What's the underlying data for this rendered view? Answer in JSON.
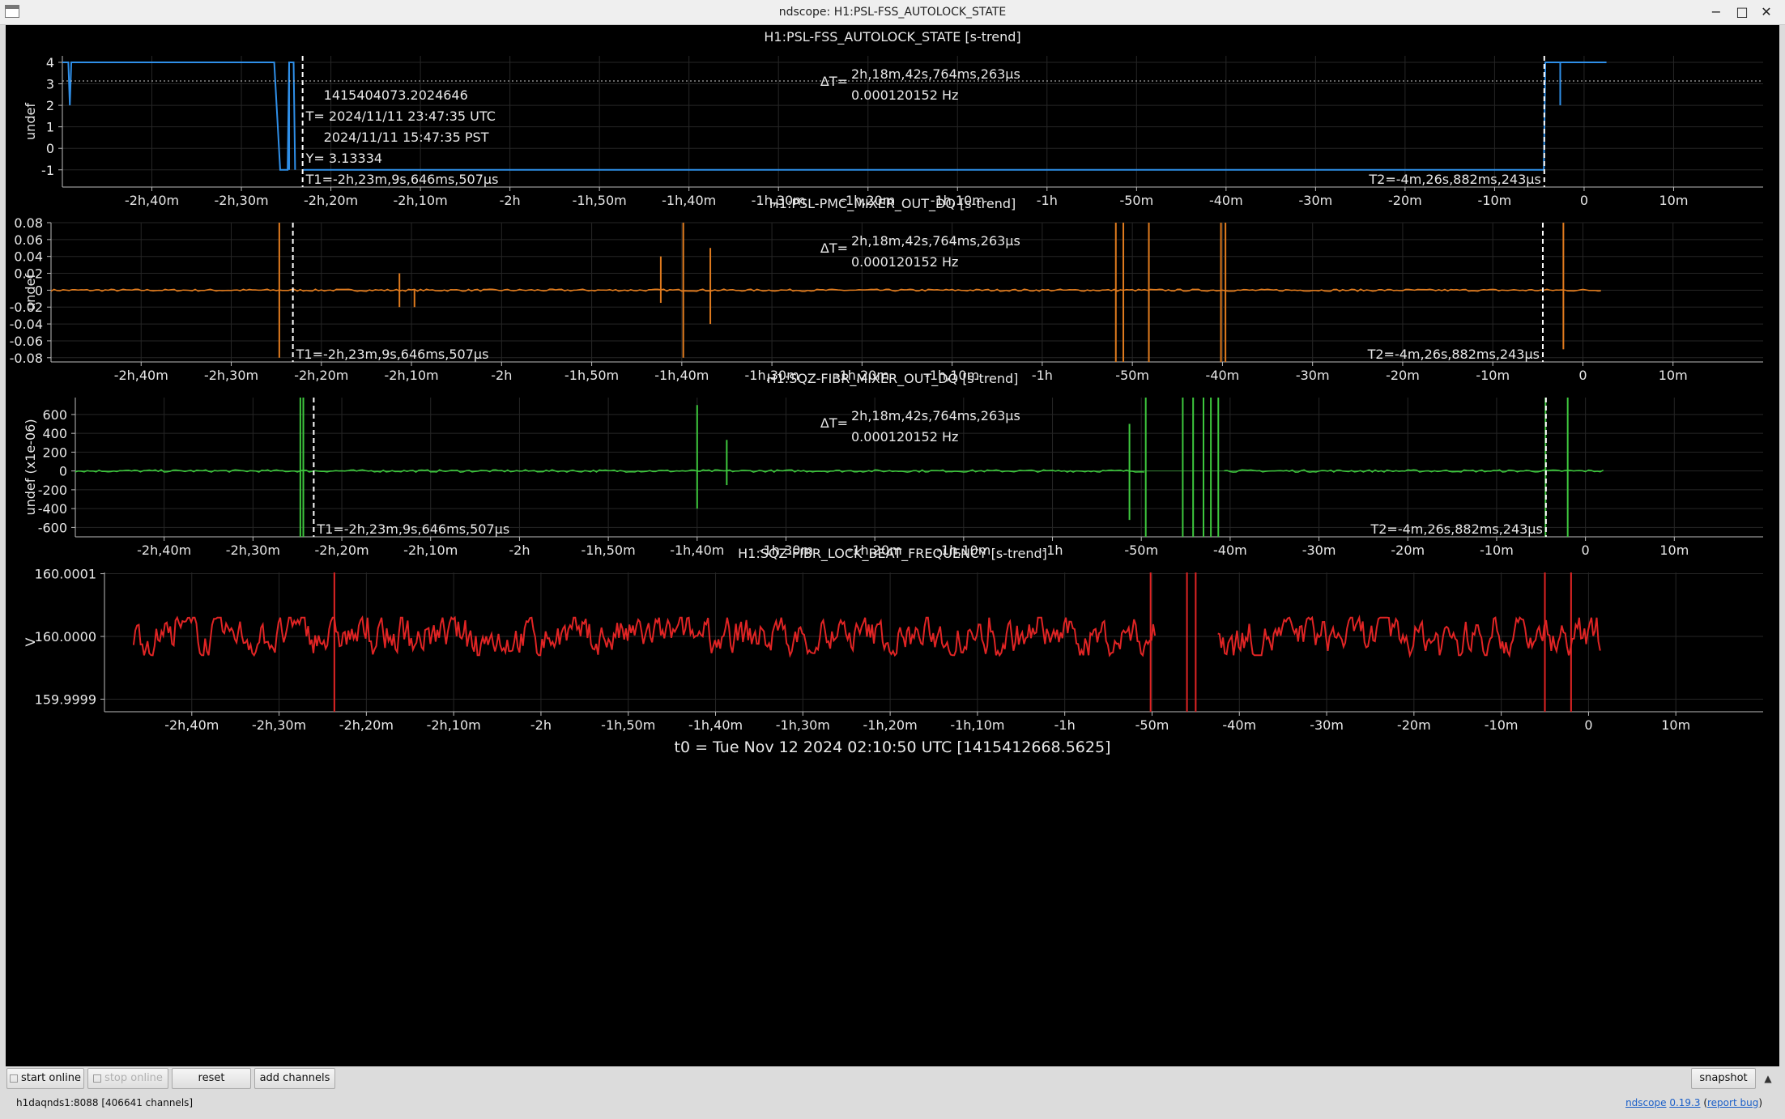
{
  "window": {
    "title": "ndscope: H1:PSL-FSS_AUTOLOCK_STATE",
    "minimize": "−",
    "restore": "□",
    "close": "✕"
  },
  "xaxis": {
    "range": [
      -10200,
      1200
    ],
    "ticks": [
      {
        "v": -9600,
        "label": "-2h,40m"
      },
      {
        "v": -9000,
        "label": "-2h,30m"
      },
      {
        "v": -8400,
        "label": "-2h,20m"
      },
      {
        "v": -7800,
        "label": "-2h,10m"
      },
      {
        "v": -7200,
        "label": "-2h"
      },
      {
        "v": -6600,
        "label": "-1h,50m"
      },
      {
        "v": -6000,
        "label": "-1h,40m"
      },
      {
        "v": -5400,
        "label": "-1h,30m"
      },
      {
        "v": -4800,
        "label": "-1h,20m"
      },
      {
        "v": -4200,
        "label": "-1h,10m"
      },
      {
        "v": -3600,
        "label": "-1h"
      },
      {
        "v": -3000,
        "label": "-50m"
      },
      {
        "v": -2400,
        "label": "-40m"
      },
      {
        "v": -1800,
        "label": "-30m"
      },
      {
        "v": -1200,
        "label": "-20m"
      },
      {
        "v": -600,
        "label": "-10m"
      },
      {
        "v": 0,
        "label": "0"
      },
      {
        "v": 600,
        "label": "10m"
      }
    ]
  },
  "cursors": {
    "t1": -8589.6,
    "t2": -266.9,
    "t1_label": "T1=-2h,23m,9s,646ms,507µs",
    "t2_label": "T2=-4m,26s,882ms,243µs",
    "dt_prefix": "ΔT=",
    "dt_value": "2h,18m,42s,764ms,263µs",
    "dt_freq": "0.000120152 Hz",
    "y_cursor": 3.13334,
    "readout": {
      "gps": "1415404073.2024646",
      "utc": "T= 2024/11/11 23:47:35 UTC",
      "pst": "2024/11/11 15:47:35 PST",
      "y": "Y= 3.13334"
    }
  },
  "t0_label": "t0 = Tue Nov 12 2024 02:10:50 UTC [1415412668.5625]",
  "chart_data": [
    {
      "type": "line",
      "title": "H1:PSL-FSS_AUTOLOCK_STATE [s-trend]",
      "ylabel": "undef",
      "ylim": [
        -1.8,
        4.3
      ],
      "yticks": [
        {
          "v": 4,
          "label": "4"
        },
        {
          "v": 3,
          "label": "3"
        },
        {
          "v": 2,
          "label": "2"
        },
        {
          "v": 1,
          "label": "1"
        },
        {
          "v": 0,
          "label": "0"
        },
        {
          "v": -1,
          "label": "-1"
        }
      ],
      "color": "#2f8fe8",
      "segments": [
        [
          [
            -10200,
            4
          ],
          [
            -10160,
            4
          ],
          [
            -10150,
            2
          ],
          [
            -10140,
            4
          ],
          [
            -8780,
            4
          ],
          [
            -8760,
            1.5
          ],
          [
            -8740,
            -1
          ],
          [
            -8690,
            -1
          ],
          [
            -8680,
            4
          ],
          [
            -8650,
            4
          ],
          [
            -8640,
            -1
          ]
        ],
        [
          [
            -8589,
            -1
          ],
          [
            -270,
            -1
          ],
          [
            -260,
            4
          ],
          [
            0,
            4
          ],
          [
            150,
            4
          ]
        ]
      ],
      "spikes": [
        [
          -8680,
          -1
        ],
        [
          -160,
          2
        ]
      ]
    },
    {
      "type": "line",
      "title": "H1:PSL-PMC_MIXER_OUT_DQ [s-trend]",
      "ylabel": "undef",
      "ylim": [
        -0.085,
        0.08
      ],
      "yticks": [
        {
          "v": 0.08,
          "label": "0.08"
        },
        {
          "v": 0.06,
          "label": "0.06"
        },
        {
          "v": 0.04,
          "label": "0.04"
        },
        {
          "v": 0.02,
          "label": "0.02"
        },
        {
          "v": 0,
          "label": "0"
        },
        {
          "v": -0.02,
          "label": "-0.02"
        },
        {
          "v": -0.04,
          "label": "-0.04"
        },
        {
          "v": -0.06,
          "label": "-0.06"
        },
        {
          "v": -0.08,
          "label": "-0.08"
        }
      ],
      "color": "#e07b1e",
      "x_end": 120,
      "noise": 0.0025,
      "spikes": [
        [
          -8680,
          0.08,
          -0.08
        ],
        [
          -7880,
          0.02,
          -0.02
        ],
        [
          -7780,
          0,
          -0.02
        ],
        [
          -6140,
          0.04,
          -0.015
        ],
        [
          -5990,
          0.08,
          -0.08
        ],
        [
          -5810,
          0.05,
          -0.04
        ],
        [
          -3110,
          0.08,
          -0.085
        ],
        [
          -3060,
          0.08,
          -0.085
        ],
        [
          -2890,
          0.08,
          -0.085
        ],
        [
          -2410,
          0.08,
          -0.085
        ],
        [
          -2380,
          0.08,
          -0.085
        ],
        [
          -130,
          0.08,
          -0.07
        ]
      ]
    },
    {
      "type": "line",
      "title": "H1:SQZ-FIBR_MIXER_OUT_DQ [s-trend]",
      "ylabel": "undef (x1e-06)",
      "ylim": [
        -700,
        780
      ],
      "yticks": [
        {
          "v": 600,
          "label": "600"
        },
        {
          "v": 400,
          "label": "400"
        },
        {
          "v": 200,
          "label": "200"
        },
        {
          "v": 0,
          "label": "0"
        },
        {
          "v": -200,
          "label": "-200"
        },
        {
          "v": -400,
          "label": "-400"
        },
        {
          "v": -600,
          "label": "-600"
        }
      ],
      "color": "#3ec83e",
      "x_end": 120,
      "noise": 25,
      "spikes": [
        [
          -8680,
          780,
          -700
        ],
        [
          -8660,
          780,
          -700
        ],
        [
          -6000,
          700,
          -400
        ],
        [
          -5800,
          330,
          -150
        ],
        [
          -3080,
          500,
          -520
        ],
        [
          -2970,
          780,
          -700
        ],
        [
          -2720,
          780,
          -700
        ],
        [
          -2650,
          780,
          -700
        ],
        [
          -2580,
          780,
          -700
        ],
        [
          -2530,
          780,
          -700
        ],
        [
          -2480,
          780,
          -700
        ],
        [
          -270,
          780,
          -700
        ],
        [
          -120,
          780,
          -700
        ]
      ],
      "gaps": [
        [
          -2980,
          -2450
        ]
      ]
    },
    {
      "type": "line",
      "title": "H1:SQZ-FIBR_LOCK_BEAT_FREQUENCY [s-trend]",
      "ylabel": "V",
      "ylim": [
        159.99988,
        160.000102
      ],
      "yticks": [
        {
          "v": 160.0001,
          "label": "160.0001"
        },
        {
          "v": 160.0,
          "label": "160.0000"
        },
        {
          "v": 159.9999,
          "label": "159.9999"
        }
      ],
      "color": "#e02424",
      "x_start": -10000,
      "x_end": 80,
      "center": 160.0,
      "noise": 3e-05,
      "spikes": [
        [
          -8620,
          160.000102,
          159.99988
        ],
        [
          -3010,
          160.000102,
          159.99988
        ],
        [
          -2760,
          160.000102,
          159.99988
        ],
        [
          -2700,
          160.000102,
          159.99988
        ],
        [
          -300,
          160.000102,
          159.99988
        ],
        [
          -120,
          160.000102,
          159.99988
        ]
      ],
      "gaps": [
        [
          -2980,
          -2550
        ]
      ]
    }
  ],
  "toolbar": {
    "start_online": "start online",
    "stop_online": "stop online",
    "reset": "reset",
    "add_channels": "add channels",
    "snapshot": "snapshot",
    "collapse": "▲"
  },
  "status": {
    "server": "h1daqnds1:8088",
    "channels": "[406641 channels]",
    "app_link": "ndscope",
    "version_link": "0.19.3",
    "report_link": "report bug"
  }
}
